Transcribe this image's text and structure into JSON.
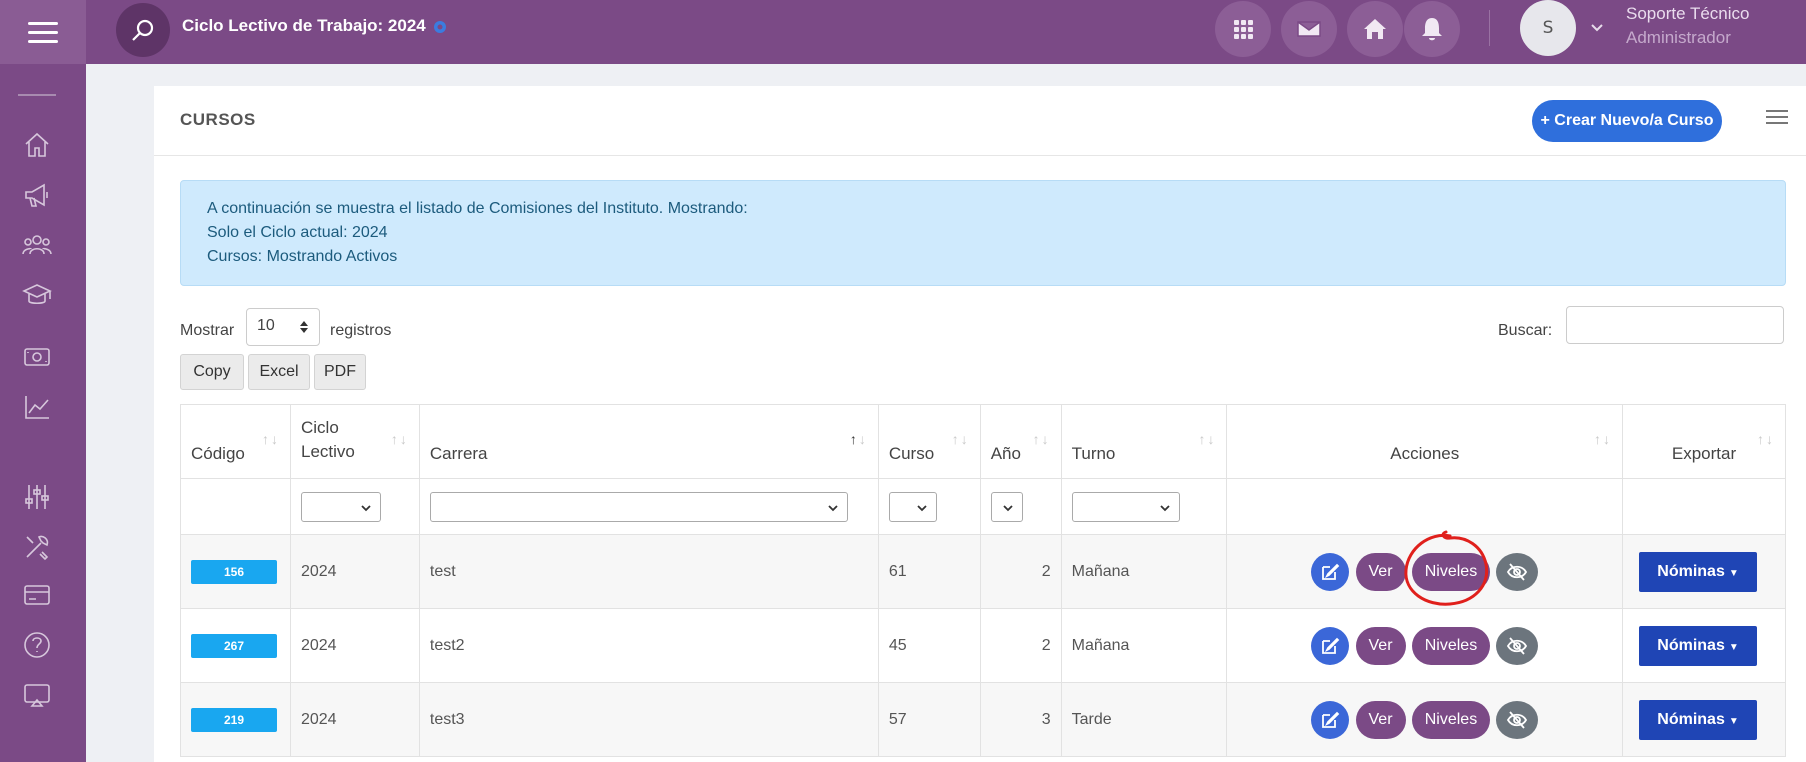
{
  "topbar": {
    "cycle_title": "Ciclo Lectivo de Trabajo: 2024",
    "avatar_initial": "S",
    "user_name": "Soporte Técnico",
    "user_role": "Administrador"
  },
  "sidebar": {
    "icons": [
      "home-icon",
      "megaphone-icon",
      "users-icon",
      "graduation-cap-icon",
      "money-icon",
      "chart-icon",
      "sliders-icon",
      "tools-icon",
      "card-icon",
      "help-icon",
      "cast-icon"
    ]
  },
  "card": {
    "title": "CURSOS",
    "create_label": "+ Crear Nuevo/a Curso"
  },
  "alert": {
    "line1": "A continuación se muestra el listado de Comisiones del Instituto. Mostrando:",
    "line2": "Solo el Ciclo actual: 2024",
    "line3": "Cursos: Mostrando Activos"
  },
  "table_controls": {
    "show_label": "Mostrar",
    "page_length": "10",
    "records_label": "registros",
    "search_label": "Buscar:",
    "export_buttons": [
      "Copy",
      "Excel",
      "PDF"
    ]
  },
  "table": {
    "headers": {
      "codigo": "Código",
      "ciclo": "Ciclo Lectivo",
      "carrera": "Carrera",
      "curso": "Curso",
      "anio": "Año",
      "turno": "Turno",
      "acciones": "Acciones",
      "exportar": "Exportar"
    },
    "action_labels": {
      "ver": "Ver",
      "niveles": "Niveles"
    },
    "export_label": "Nóminas",
    "rows": [
      {
        "codigo": "156",
        "ciclo": "2024",
        "carrera": "test",
        "curso": "61",
        "anio": "2",
        "turno": "Mañana"
      },
      {
        "codigo": "267",
        "ciclo": "2024",
        "carrera": "test2",
        "curso": "45",
        "anio": "2",
        "turno": "Mañana"
      },
      {
        "codigo": "219",
        "ciclo": "2024",
        "carrera": "test3",
        "curso": "57",
        "anio": "3",
        "turno": "Tarde"
      }
    ]
  },
  "colors": {
    "brand_purple": "#7b4a86",
    "primary_blue": "#2f6fdc",
    "badge_blue": "#19a7f0",
    "annotation_red": "#e0201c"
  }
}
